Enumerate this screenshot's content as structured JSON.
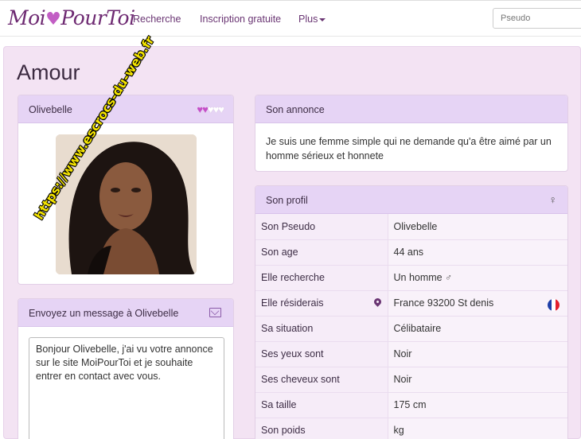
{
  "navbar": {
    "logo_before": "Moi",
    "logo_heart": "♥",
    "logo_after": "PourToi",
    "links": [
      "Recherche",
      "Inscription gratuite",
      "Plus"
    ],
    "search_placeholder": "Pseudo"
  },
  "page": {
    "title": "Amour"
  },
  "profile_card": {
    "name": "Olivebelle",
    "hearts": {
      "filled": 2,
      "total": 5
    },
    "watermark": "https://www.escrocs-du-web.fr"
  },
  "message_card": {
    "title": "Envoyez un message à Olivebelle",
    "message": "Bonjour Olivebelle, j'ai vu votre annonce sur le site MoiPourToi et je souhaite entrer en contact avec vous."
  },
  "annonce": {
    "title": "Son annonce",
    "text": "Je suis une femme simple qui ne demande qu'a être aimé par un homme sérieux et honnete"
  },
  "profil": {
    "title": "Son profil",
    "rows": [
      {
        "label": "Son Pseudo",
        "value": "Olivebelle"
      },
      {
        "label": "Son age",
        "value": "44 ans"
      },
      {
        "label": "Elle recherche",
        "value": "Un homme"
      },
      {
        "label": "Elle résiderais",
        "value": "France 93200 St denis"
      },
      {
        "label": "Sa situation",
        "value": "Célibataire"
      },
      {
        "label": "Ses yeux sont",
        "value": "Noir"
      },
      {
        "label": "Ses cheveux sont",
        "value": "Noir"
      },
      {
        "label": "Sa taille",
        "value": "175 cm"
      },
      {
        "label": "Son poids",
        "value": "kg"
      }
    ]
  },
  "colors": {
    "brand": "#6e2a72",
    "panel_heading": "#e6d4f5",
    "page_bg": "#f3e3f3"
  }
}
